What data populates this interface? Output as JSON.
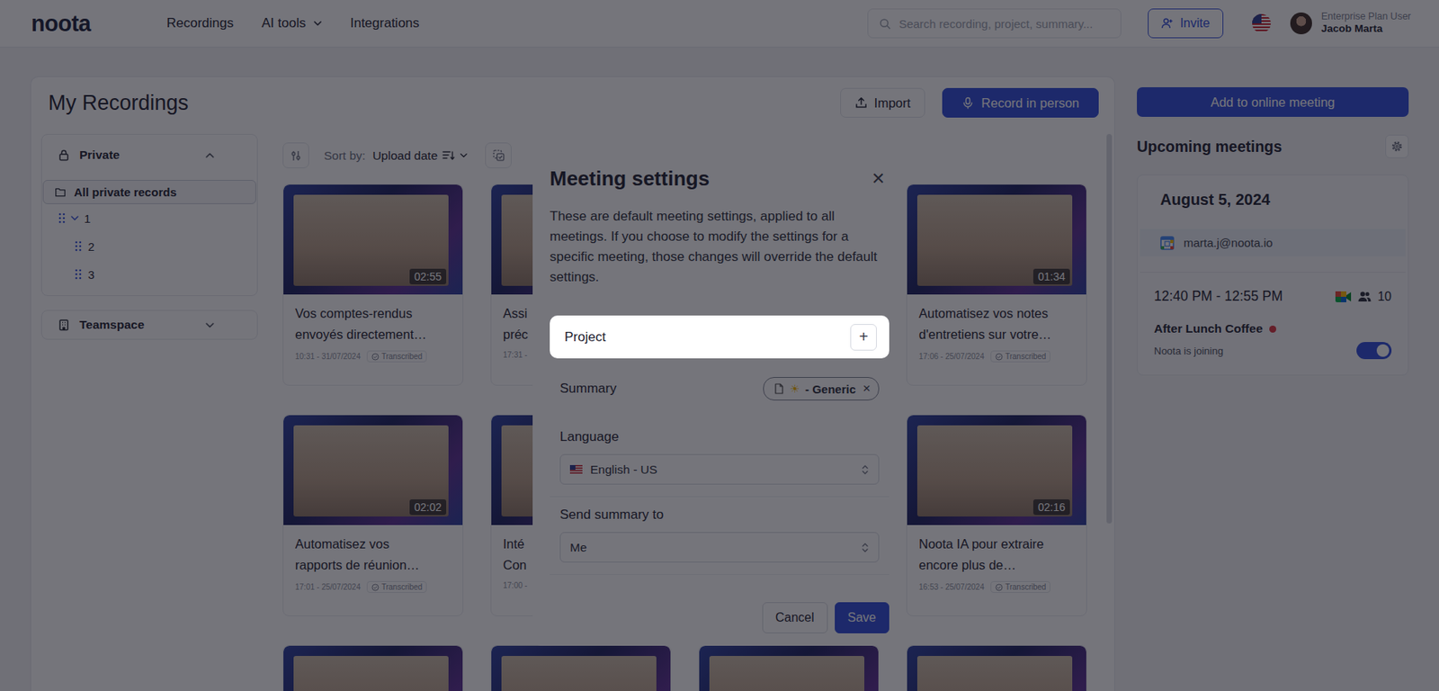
{
  "topbar": {
    "logo": "noota",
    "nav": [
      {
        "label": "Recordings",
        "dropdown": false
      },
      {
        "label": "AI tools",
        "dropdown": true
      },
      {
        "label": "Integrations",
        "dropdown": false
      }
    ],
    "search": {
      "placeholder": "Search recording, project, summary..."
    },
    "invite": "Invite",
    "user": {
      "plan": "Enterprise Plan User",
      "name": "Jacob Marta"
    }
  },
  "page": {
    "title": "My Recordings",
    "buttons": [
      {
        "label": "Import",
        "kind": "import",
        "primary": false
      },
      {
        "label": "Record in person",
        "kind": "record",
        "primary": true
      }
    ]
  },
  "sidebar": {
    "sections": [
      {
        "label": "Private",
        "kind": "private",
        "expanded": true,
        "items": [
          {
            "label": "All private records",
            "kind": "folder",
            "selected": true,
            "expanded": false
          },
          {
            "label": "1",
            "kind": "group",
            "selected": false,
            "expanded": true
          },
          {
            "label": "2",
            "kind": "child",
            "selected": false,
            "expanded": false
          },
          {
            "label": "3",
            "kind": "child",
            "selected": false,
            "expanded": false
          }
        ]
      },
      {
        "label": "Teamspace",
        "kind": "team",
        "expanded": false,
        "items": []
      }
    ]
  },
  "toolbar": {
    "sort_label": "Sort by:",
    "sort_value": "Upload date"
  },
  "cards": [
    {
      "duration": "02:55",
      "title_lines": [
        "Vos comptes-rendus",
        "envoyés directement…"
      ],
      "date": "10:31 - 31/07/2024",
      "status": "Transcribed"
    },
    {
      "duration": "",
      "title_lines": [
        "Assi",
        "préc"
      ],
      "date": "17:31 -",
      "status": ""
    },
    {
      "duration": "",
      "title_lines": [],
      "date": "",
      "status": ""
    },
    {
      "duration": "01:34",
      "title_lines": [
        "Automatisez vos notes",
        "d'entretiens sur votre…"
      ],
      "date": "17:06 - 25/07/2024",
      "status": "Transcribed"
    },
    {
      "duration": "02:02",
      "title_lines": [
        "Automatisez vos",
        "rapports de réunion…"
      ],
      "date": "17:01 - 25/07/2024",
      "status": "Transcribed"
    },
    {
      "duration": "",
      "title_lines": [
        "Inté",
        "Con"
      ],
      "date": "17:00 -",
      "status": ""
    },
    {
      "duration": "",
      "title_lines": [],
      "date": "",
      "status": ""
    },
    {
      "duration": "02:16",
      "title_lines": [
        "Noota IA pour extraire",
        "encore plus de…"
      ],
      "date": "16:53 - 25/07/2024",
      "status": "Transcribed"
    },
    {
      "duration": "",
      "title_lines": [],
      "date": "",
      "status": ""
    },
    {
      "duration": "",
      "title_lines": [],
      "date": "",
      "status": ""
    },
    {
      "duration": "",
      "title_lines": [],
      "date": "",
      "status": ""
    },
    {
      "duration": "",
      "title_lines": [],
      "date": "",
      "status": ""
    }
  ],
  "right": {
    "button": "Add to online meeting",
    "title": "Upcoming meetings",
    "date": "August 5, 2024",
    "calendar": "marta.j@noota.io",
    "meeting": {
      "time": "12:40 PM - 12:55 PM",
      "participants": "10",
      "title": "After Lunch Coffee",
      "status": "Noota is joining",
      "on": true
    }
  },
  "modal": {
    "title": "Meeting settings",
    "close": "×",
    "description": "These are default meeting settings, applied to all meetings. If you choose to modify the settings for a specific meeting, those changes will override the default settings.",
    "fields": [
      {
        "kind": "add",
        "label": "Project",
        "action": "+",
        "highlighted": true
      },
      {
        "kind": "chip",
        "label": "Summary",
        "chip": {
          "icon": "☀",
          "text": "- Generic",
          "remove": "×"
        }
      },
      {
        "kind": "select",
        "label": "Language",
        "value": "English - US",
        "flag": true
      },
      {
        "kind": "select",
        "label": "Send summary to",
        "value": "Me",
        "flag": false
      }
    ],
    "buttons": [
      {
        "label": "Cancel",
        "primary": false
      },
      {
        "label": "Save",
        "primary": true
      }
    ]
  }
}
